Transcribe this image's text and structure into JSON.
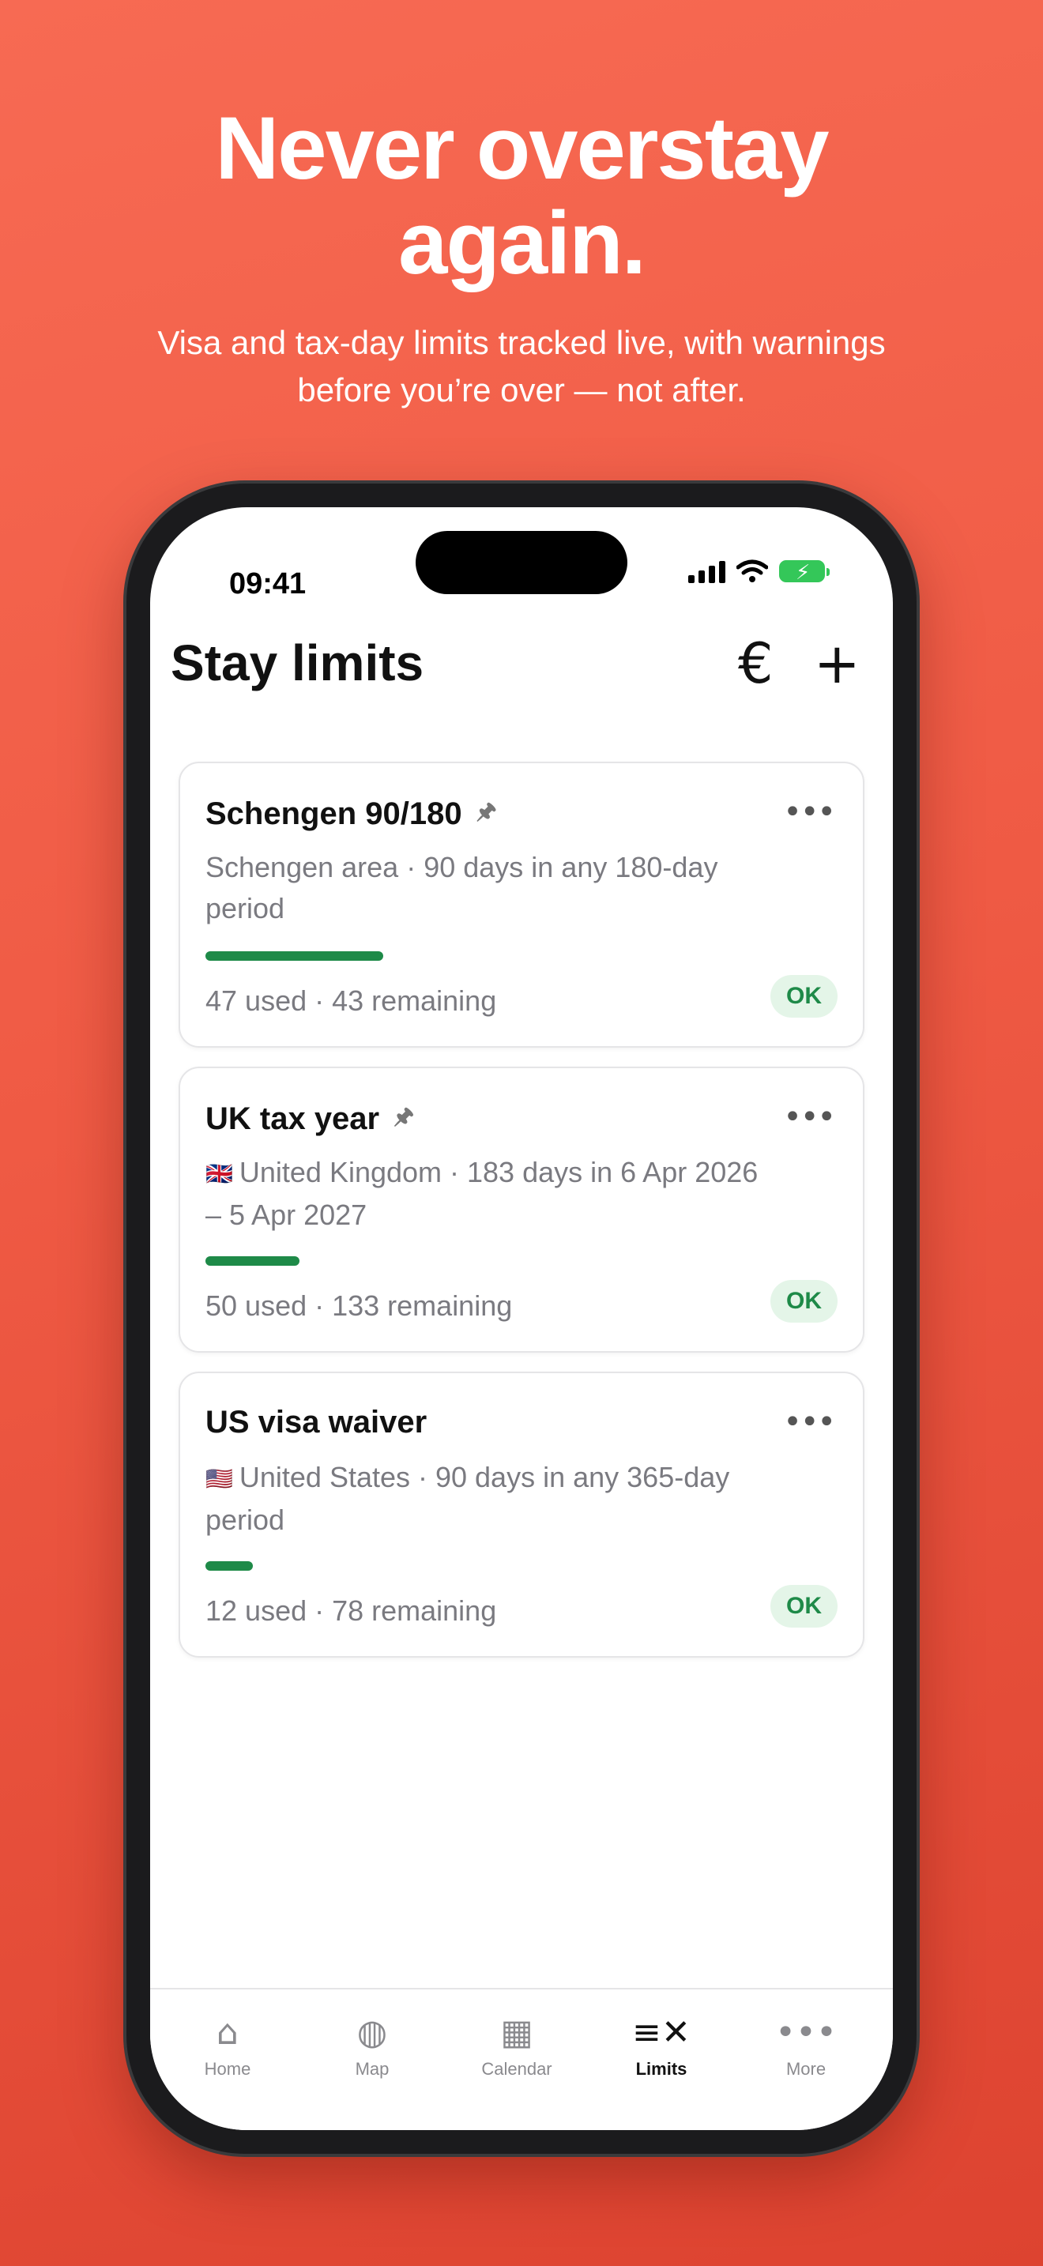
{
  "hero": {
    "headline_line1": "Never overstay",
    "headline_line2": "again.",
    "subhead_line1": "Visa and tax-day limits tracked live, with warnings",
    "subhead_line2": "before you’re over — not after."
  },
  "status_bar": {
    "time": "09:41"
  },
  "header": {
    "title": "Stay limits",
    "currency_icon": "€",
    "add_icon": "+"
  },
  "cards": [
    {
      "title": "Schengen 90/180",
      "pinned": true,
      "flag": "",
      "sub_line1": "Schengen area ·  90 days in any 180-day",
      "sub_line2": "period",
      "stats": "47 used · 43 remaining",
      "used": 47,
      "limit": 90,
      "badge": "OK"
    },
    {
      "title": "UK tax year",
      "pinned": true,
      "flag": "🇬🇧",
      "sub_line1": "United Kingdom ·  183 days in 6 Apr 2026",
      "sub_line2": "– 5 Apr 2027",
      "stats": "50 used · 133 remaining",
      "used": 50,
      "limit": 183,
      "badge": "OK"
    },
    {
      "title": "US visa waiver",
      "pinned": false,
      "flag": "🇺🇸",
      "sub_line1": "United States ·  90 days in any 365-day",
      "sub_line2": "period",
      "stats": "12 used · 78 remaining",
      "used": 12,
      "limit": 90,
      "badge": "OK"
    }
  ],
  "tabbar": {
    "items": [
      {
        "label": "Home",
        "icon": "home-icon"
      },
      {
        "label": "Map",
        "icon": "globe-icon"
      },
      {
        "label": "Calendar",
        "icon": "calendar-icon"
      },
      {
        "label": "Limits",
        "icon": "limits-icon",
        "active": true
      },
      {
        "label": "More",
        "icon": "more-icon"
      }
    ]
  },
  "colors": {
    "accent": "#1e8a48",
    "background": "#ef5a44",
    "badge_bg": "#e4f5e8"
  }
}
